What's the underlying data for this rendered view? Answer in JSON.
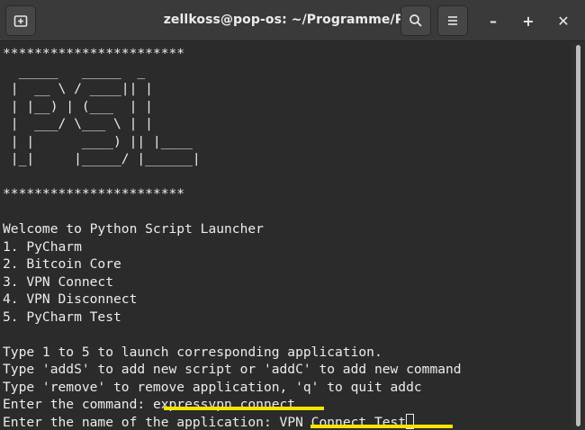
{
  "window": {
    "title": "zellkoss@pop-os: ~/Programme/PSL"
  },
  "toolbar": {
    "new_tab_icon": "new-tab-icon",
    "search_icon": "search-icon",
    "menu_icon": "hamburger-menu-icon",
    "minimize_glyph": "–",
    "maximize_glyph": "+",
    "close_glyph": "✕"
  },
  "terminal": {
    "lines": [
      "***********************",
      "  _____   _____  _     ",
      " |  __ \\ / ____|| |    ",
      " | |__) | (___  | |    ",
      " |  ___/ \\___ \\ | |    ",
      " | |      ____) || |____",
      " |_|     |_____/ |______|",
      "",
      "***********************",
      "",
      "Welcome to Python Script Launcher",
      "1. PyCharm",
      "2. Bitcoin Core",
      "3. VPN Connect",
      "4. VPN Disconnect",
      "5. PyCharm Test",
      "",
      "Type 1 to 5 to launch corresponding application.",
      "Type 'addS' to add new script or 'addC' to add new command",
      "Type 'remove' to remove application, 'q' to quit addc"
    ],
    "prompt_command_label": "Enter the command: ",
    "prompt_command_value": "expressvpn connect",
    "prompt_name_label": "Enter the name of the application: ",
    "prompt_name_value": "VPN Connect Test"
  },
  "colors": {
    "highlight": "#f5e500",
    "terminal_bg": "#2b2b2b",
    "titlebar_bg": "#3a3a3a",
    "text": "#ececec"
  }
}
